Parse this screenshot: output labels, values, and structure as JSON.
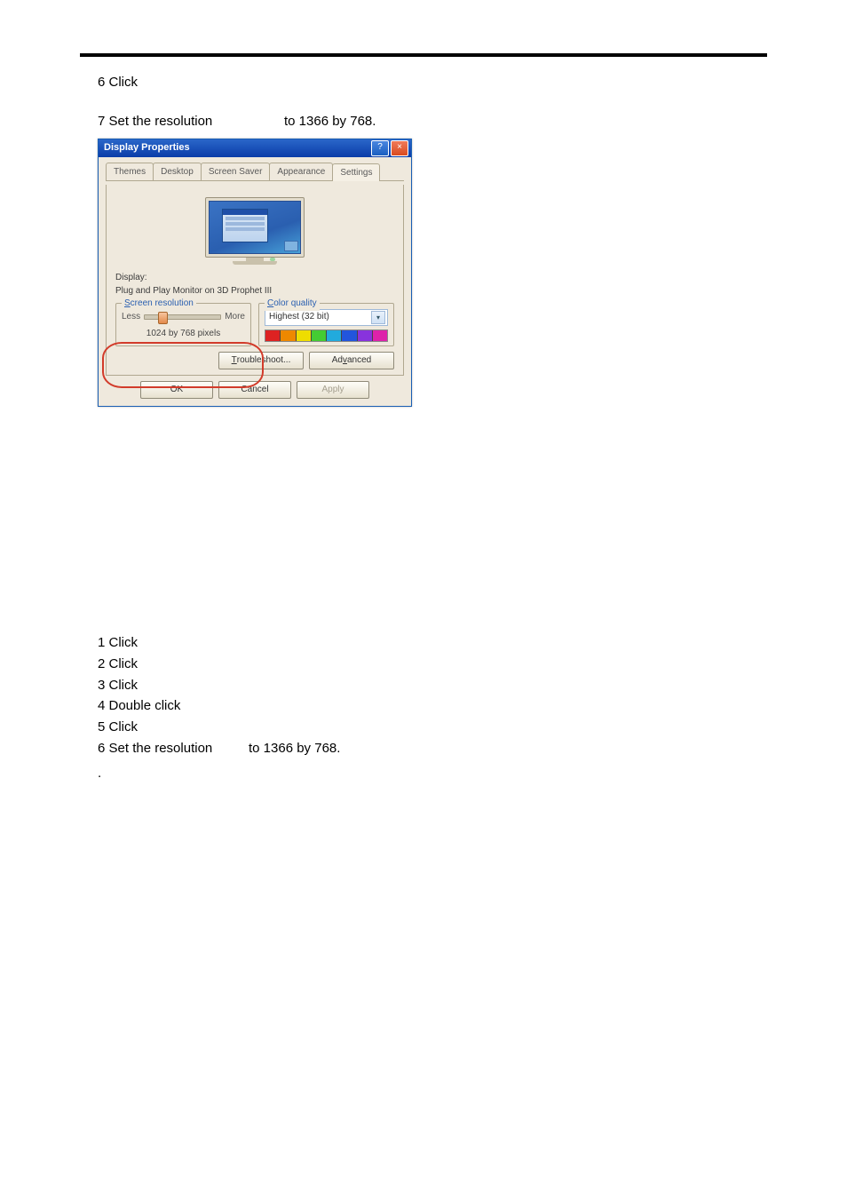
{
  "steps_top": {
    "step6": "6 Click",
    "step7_left": "7 Set the resolution",
    "step7_right": "to 1366 by 768."
  },
  "dialog": {
    "title": "Display Properties",
    "help": "?",
    "close": "×",
    "tabs": {
      "themes": "Themes",
      "desktop": "Desktop",
      "saver": "Screen Saver",
      "appearance": "Appearance",
      "settings": "Settings"
    },
    "display_label": "Display:",
    "display_value": "Plug and Play Monitor on 3D Prophet III",
    "reso_group": "Screen resolution",
    "less": "Less",
    "more": "More",
    "reso_val": "1024 by 768 pixels",
    "quality_group": "Color quality",
    "quality_val": "Highest (32 bit)",
    "troubleshoot": "Troubleshoot...",
    "advanced": "Advanced",
    "ok": "OK",
    "cancel": "Cancel",
    "apply": "Apply"
  },
  "steps_bottom": {
    "s1": "1 Click",
    "s2": "2 Click",
    "s3": "3 Click",
    "s4": "4 Double click",
    "s5": "5 Click",
    "s6_left": "6 Set the resolution",
    "s6_right": "to 1366 by 768.",
    "dot": "."
  }
}
